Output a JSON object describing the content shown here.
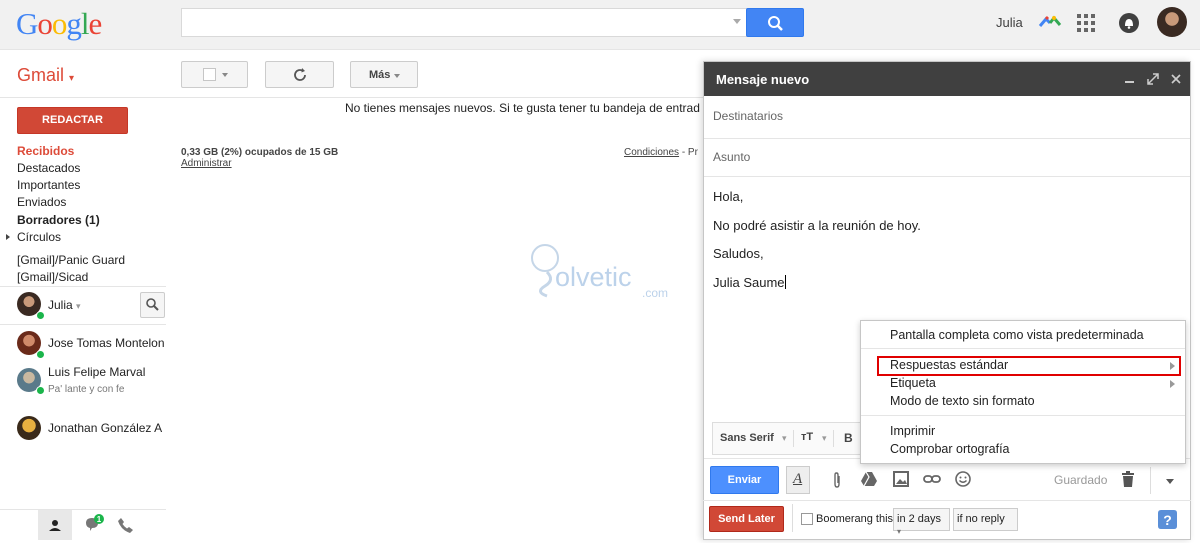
{
  "header": {
    "logo": "Google",
    "user_name": "Julia"
  },
  "gmail": {
    "label": "Gmail",
    "more_label": "Más",
    "compose_label": "REDACTAR",
    "nav": [
      {
        "label": "Recibidos",
        "bold": true,
        "active": true
      },
      {
        "label": "Destacados"
      },
      {
        "label": "Importantes"
      },
      {
        "label": "Enviados"
      },
      {
        "label": "Borradores (1)",
        "bold": true
      },
      {
        "label": "Círculos"
      },
      {
        "label": "[Gmail]/Panic Guard"
      },
      {
        "label": "[Gmail]/Sicad"
      }
    ],
    "chat": {
      "self_name": "Julia",
      "contacts": [
        {
          "name": "Jose Tomas Montelon"
        },
        {
          "name": "Luis Felipe Marval",
          "status": "Pa' lante y con fe"
        },
        {
          "name": "Jonathan González A"
        }
      ],
      "badge_count": "1"
    },
    "empty_message": "No tienes mensajes nuevos. Si te gusta tener tu bandeja de entrad",
    "storage": "0,33 GB (2%) ocupados de 15 GB",
    "manage_link": "Administrar",
    "terms_link": "Condiciones",
    "terms_sep": " - Pr",
    "watermark": "olvetic",
    "watermark_suffix": ".com"
  },
  "compose": {
    "title": "Mensaje nuevo",
    "to_placeholder": "Destinatarios",
    "subject_placeholder": "Asunto",
    "body": [
      "Hola,",
      "No podré asistir a la reunión de hoy.",
      "Saludos,",
      "Julia Saume"
    ],
    "font_name": "Sans Serif",
    "send_label": "Enviar",
    "saved_label": "Guardado",
    "send_later_label": "Send Later",
    "boomerang_label": "Boomerang this",
    "delay_option": "in 2 days",
    "condition_option": "if no reply"
  },
  "menu": {
    "items": [
      {
        "label": "Pantalla completa como vista predeterminada"
      },
      {
        "label": "Respuestas estándar",
        "submenu": true,
        "highlighted": true
      },
      {
        "label": "Etiqueta",
        "submenu": true
      },
      {
        "label": "Modo de texto sin formato"
      },
      {
        "label": "Imprimir"
      },
      {
        "label": "Comprobar ortografía"
      }
    ]
  },
  "colors": {
    "accent_red": "#dd4b39",
    "blue": "#4285f4",
    "highlight": "#e00000"
  }
}
